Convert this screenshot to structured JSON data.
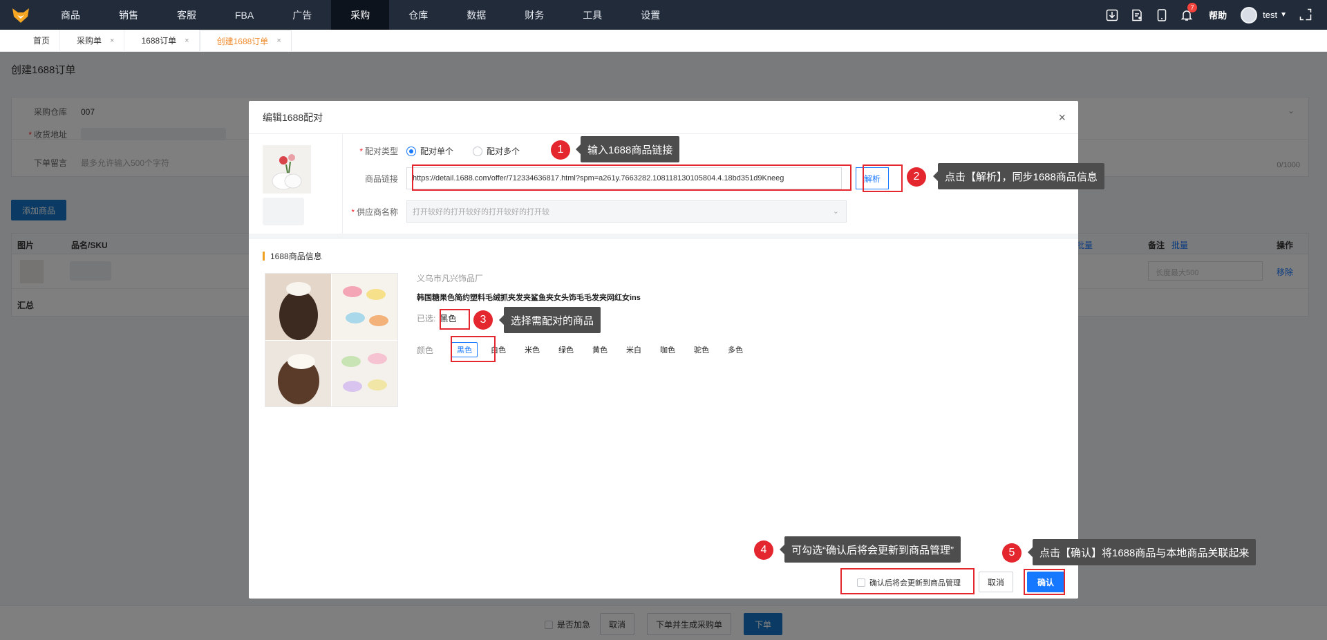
{
  "nav": {
    "items": [
      "商品",
      "销售",
      "客服",
      "FBA",
      "广告",
      "采购",
      "仓库",
      "数据",
      "财务",
      "工具",
      "设置"
    ],
    "active": "采购",
    "notification_count": "7",
    "help_label": "帮助",
    "username": "test",
    "brand_color": "#f5a623"
  },
  "tabs": [
    {
      "label": "首页"
    },
    {
      "label": "采购单",
      "close": "×"
    },
    {
      "label": "1688订单",
      "close": "×"
    },
    {
      "label": "创建1688订单",
      "close": "×"
    }
  ],
  "page": {
    "title": "创建1688订单",
    "form": {
      "warehouse_label": "采购仓库",
      "warehouse_value": "007",
      "address_label": "收货地址",
      "message_label": "下单留言",
      "message_placeholder": "最多允许输入500个字符",
      "message_counter": "0/1000"
    },
    "add_product_button": "添加商品",
    "table": {
      "columns": [
        "图片",
        "品名/SKU",
        "量",
        "备注",
        "操作"
      ],
      "batch_label": "批量",
      "remark_placeholder": "长度最大500",
      "remove_label": "移除",
      "sum_label": "汇总"
    },
    "bottom": {
      "urgent_label": "是否加急",
      "cancel": "取消",
      "order_and_po": "下单并生成采购单",
      "order": "下单"
    }
  },
  "modal": {
    "title": "编辑1688配对",
    "close": "×",
    "pair_type_label": "配对类型",
    "pair_single": "配对单个",
    "pair_multiple": "配对多个",
    "link_label": "商品链接",
    "link_value": "https://detail.1688.com/offer/712334636817.html?spm=a261y.7663282.10811813010580​4.4.18bd351d9Kneeg",
    "parse_button": "解析",
    "supplier_label": "供应商名称",
    "supplier_placeholder": "打开较好的打开较好的打开较好的打开较",
    "info_title": "1688商品信息",
    "factory": "义乌市凡兴饰品厂",
    "product_name": "韩国糖果色简约塑料毛绒抓夹发夹鲨鱼夹女头饰毛毛发夹网红女ins",
    "selected_label": "已选:",
    "selected_value": "黑色",
    "color_label": "颜色",
    "colors": [
      "黑色",
      "白色",
      "米色",
      "绿色",
      "黄色",
      "米白",
      "咖色",
      "驼色",
      "多色"
    ],
    "selected_color": "黑色",
    "update_checkbox_label": "确认后将会更新到商品管理",
    "cancel_button": "取消",
    "confirm_button": "确认"
  },
  "annotations": [
    {
      "num": "1",
      "text": "输入1688商品链接"
    },
    {
      "num": "2",
      "text": "点击【解析】，同步1688商品信息"
    },
    {
      "num": "3",
      "text": "选择需配对的商品"
    },
    {
      "num": "4",
      "text": "可勾选“确认后将会更新到商品管理”"
    },
    {
      "num": "5",
      "text": "点击【确认】将1688商品与本地商品关联起来"
    }
  ],
  "colors": {
    "topbar": "#222b3a",
    "primary": "#1677ff",
    "annotation_red": "#e4262f",
    "tab_active": "#f08c2e"
  }
}
